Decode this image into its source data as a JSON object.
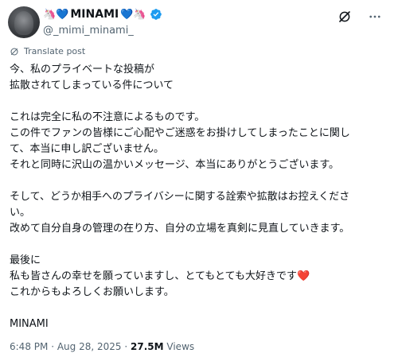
{
  "author": {
    "display_name": "MINAMI",
    "handle": "@_mimi_minami_",
    "name_emoji_left": "🦄💙",
    "name_emoji_right": "💙🦄"
  },
  "translate_label": "Translate post",
  "tweet_lines": [
    "今、私のプライベートな投稿が",
    "拡散されてしまっている件について",
    "",
    "これは完全に私の不注意によるものです。",
    "この件でファンの皆様にご心配やご迷惑をお掛けしてしまったことに関し",
    "て、本当に申し訳ございません。",
    "それと同時に沢山の温かいメッセージ、本当にありがとうございます。",
    "",
    "そして、どうか相手へのプライバシーに関する詮索や拡散はお控えくださ",
    "い。",
    "改めて自分自身の管理の在り方、自分の立場を真剣に見直していきます。",
    "",
    "最後に",
    "私も皆さんの幸せを願っていますし、とてもとても大好きです",
    "これからもよろしくお願いします。",
    "",
    "MINAMI"
  ],
  "heart_emoji": "❤️",
  "meta": {
    "time": "6:48 PM",
    "date": "Aug 28, 2025",
    "separator": "·",
    "views_count": "27.5M",
    "views_label": "Views"
  },
  "icons": [
    "verified-badge-icon",
    "grok-icon",
    "more-icon",
    "translate-icon"
  ],
  "colors": {
    "accent_blue": "#1d9bf0",
    "secondary_text": "#536471",
    "heart_red": "#e0245e"
  }
}
